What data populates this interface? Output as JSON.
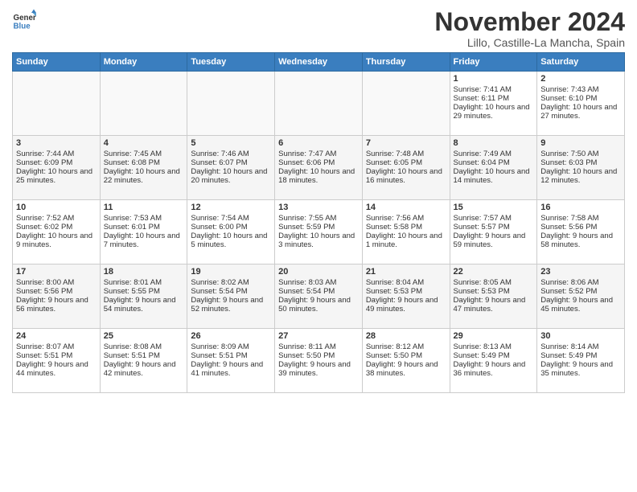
{
  "header": {
    "logo_line1": "General",
    "logo_line2": "Blue",
    "month_title": "November 2024",
    "location": "Lillo, Castille-La Mancha, Spain"
  },
  "days_of_week": [
    "Sunday",
    "Monday",
    "Tuesday",
    "Wednesday",
    "Thursday",
    "Friday",
    "Saturday"
  ],
  "weeks": [
    [
      {
        "day": "",
        "sunrise": "",
        "sunset": "",
        "daylight": ""
      },
      {
        "day": "",
        "sunrise": "",
        "sunset": "",
        "daylight": ""
      },
      {
        "day": "",
        "sunrise": "",
        "sunset": "",
        "daylight": ""
      },
      {
        "day": "",
        "sunrise": "",
        "sunset": "",
        "daylight": ""
      },
      {
        "day": "",
        "sunrise": "",
        "sunset": "",
        "daylight": ""
      },
      {
        "day": "1",
        "sunrise": "Sunrise: 7:41 AM",
        "sunset": "Sunset: 6:11 PM",
        "daylight": "Daylight: 10 hours and 29 minutes."
      },
      {
        "day": "2",
        "sunrise": "Sunrise: 7:43 AM",
        "sunset": "Sunset: 6:10 PM",
        "daylight": "Daylight: 10 hours and 27 minutes."
      }
    ],
    [
      {
        "day": "3",
        "sunrise": "Sunrise: 7:44 AM",
        "sunset": "Sunset: 6:09 PM",
        "daylight": "Daylight: 10 hours and 25 minutes."
      },
      {
        "day": "4",
        "sunrise": "Sunrise: 7:45 AM",
        "sunset": "Sunset: 6:08 PM",
        "daylight": "Daylight: 10 hours and 22 minutes."
      },
      {
        "day": "5",
        "sunrise": "Sunrise: 7:46 AM",
        "sunset": "Sunset: 6:07 PM",
        "daylight": "Daylight: 10 hours and 20 minutes."
      },
      {
        "day": "6",
        "sunrise": "Sunrise: 7:47 AM",
        "sunset": "Sunset: 6:06 PM",
        "daylight": "Daylight: 10 hours and 18 minutes."
      },
      {
        "day": "7",
        "sunrise": "Sunrise: 7:48 AM",
        "sunset": "Sunset: 6:05 PM",
        "daylight": "Daylight: 10 hours and 16 minutes."
      },
      {
        "day": "8",
        "sunrise": "Sunrise: 7:49 AM",
        "sunset": "Sunset: 6:04 PM",
        "daylight": "Daylight: 10 hours and 14 minutes."
      },
      {
        "day": "9",
        "sunrise": "Sunrise: 7:50 AM",
        "sunset": "Sunset: 6:03 PM",
        "daylight": "Daylight: 10 hours and 12 minutes."
      }
    ],
    [
      {
        "day": "10",
        "sunrise": "Sunrise: 7:52 AM",
        "sunset": "Sunset: 6:02 PM",
        "daylight": "Daylight: 10 hours and 9 minutes."
      },
      {
        "day": "11",
        "sunrise": "Sunrise: 7:53 AM",
        "sunset": "Sunset: 6:01 PM",
        "daylight": "Daylight: 10 hours and 7 minutes."
      },
      {
        "day": "12",
        "sunrise": "Sunrise: 7:54 AM",
        "sunset": "Sunset: 6:00 PM",
        "daylight": "Daylight: 10 hours and 5 minutes."
      },
      {
        "day": "13",
        "sunrise": "Sunrise: 7:55 AM",
        "sunset": "Sunset: 5:59 PM",
        "daylight": "Daylight: 10 hours and 3 minutes."
      },
      {
        "day": "14",
        "sunrise": "Sunrise: 7:56 AM",
        "sunset": "Sunset: 5:58 PM",
        "daylight": "Daylight: 10 hours and 1 minute."
      },
      {
        "day": "15",
        "sunrise": "Sunrise: 7:57 AM",
        "sunset": "Sunset: 5:57 PM",
        "daylight": "Daylight: 9 hours and 59 minutes."
      },
      {
        "day": "16",
        "sunrise": "Sunrise: 7:58 AM",
        "sunset": "Sunset: 5:56 PM",
        "daylight": "Daylight: 9 hours and 58 minutes."
      }
    ],
    [
      {
        "day": "17",
        "sunrise": "Sunrise: 8:00 AM",
        "sunset": "Sunset: 5:56 PM",
        "daylight": "Daylight: 9 hours and 56 minutes."
      },
      {
        "day": "18",
        "sunrise": "Sunrise: 8:01 AM",
        "sunset": "Sunset: 5:55 PM",
        "daylight": "Daylight: 9 hours and 54 minutes."
      },
      {
        "day": "19",
        "sunrise": "Sunrise: 8:02 AM",
        "sunset": "Sunset: 5:54 PM",
        "daylight": "Daylight: 9 hours and 52 minutes."
      },
      {
        "day": "20",
        "sunrise": "Sunrise: 8:03 AM",
        "sunset": "Sunset: 5:54 PM",
        "daylight": "Daylight: 9 hours and 50 minutes."
      },
      {
        "day": "21",
        "sunrise": "Sunrise: 8:04 AM",
        "sunset": "Sunset: 5:53 PM",
        "daylight": "Daylight: 9 hours and 49 minutes."
      },
      {
        "day": "22",
        "sunrise": "Sunrise: 8:05 AM",
        "sunset": "Sunset: 5:53 PM",
        "daylight": "Daylight: 9 hours and 47 minutes."
      },
      {
        "day": "23",
        "sunrise": "Sunrise: 8:06 AM",
        "sunset": "Sunset: 5:52 PM",
        "daylight": "Daylight: 9 hours and 45 minutes."
      }
    ],
    [
      {
        "day": "24",
        "sunrise": "Sunrise: 8:07 AM",
        "sunset": "Sunset: 5:51 PM",
        "daylight": "Daylight: 9 hours and 44 minutes."
      },
      {
        "day": "25",
        "sunrise": "Sunrise: 8:08 AM",
        "sunset": "Sunset: 5:51 PM",
        "daylight": "Daylight: 9 hours and 42 minutes."
      },
      {
        "day": "26",
        "sunrise": "Sunrise: 8:09 AM",
        "sunset": "Sunset: 5:51 PM",
        "daylight": "Daylight: 9 hours and 41 minutes."
      },
      {
        "day": "27",
        "sunrise": "Sunrise: 8:11 AM",
        "sunset": "Sunset: 5:50 PM",
        "daylight": "Daylight: 9 hours and 39 minutes."
      },
      {
        "day": "28",
        "sunrise": "Sunrise: 8:12 AM",
        "sunset": "Sunset: 5:50 PM",
        "daylight": "Daylight: 9 hours and 38 minutes."
      },
      {
        "day": "29",
        "sunrise": "Sunrise: 8:13 AM",
        "sunset": "Sunset: 5:49 PM",
        "daylight": "Daylight: 9 hours and 36 minutes."
      },
      {
        "day": "30",
        "sunrise": "Sunrise: 8:14 AM",
        "sunset": "Sunset: 5:49 PM",
        "daylight": "Daylight: 9 hours and 35 minutes."
      }
    ]
  ]
}
